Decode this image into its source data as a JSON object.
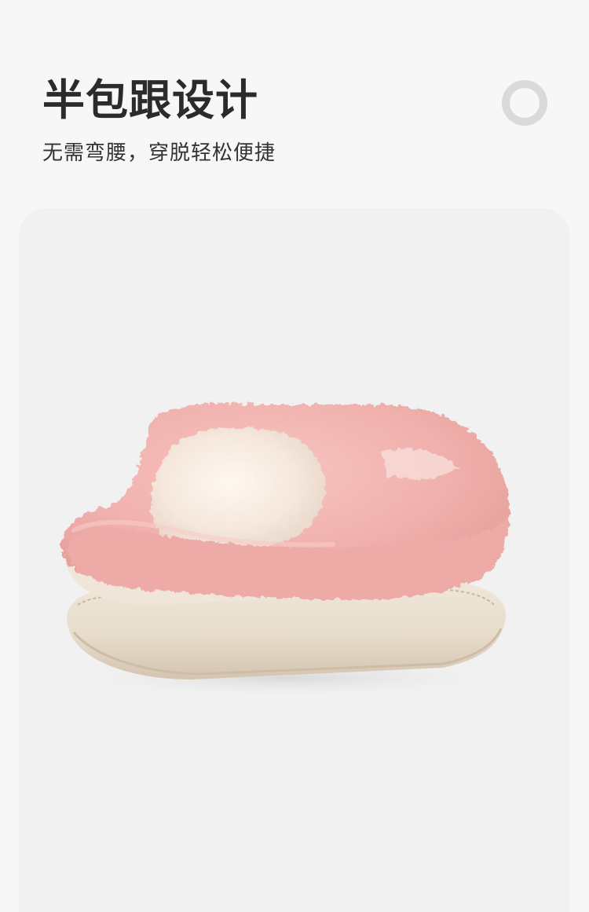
{
  "header": {
    "title": "半包跟设计",
    "subtitle": "无需弯腰，穿脱轻松便捷",
    "ring_icon": "ring-icon"
  },
  "product_image": {
    "subject": "slipper",
    "colors": {
      "fleece": "#f2b7b5",
      "fleece_shadow": "#e79f9e",
      "lining": "#f6e9df",
      "sole": "#e8ddcc",
      "sole_shadow": "#d7c7b3",
      "card_bg": "#f1f1f1"
    }
  }
}
